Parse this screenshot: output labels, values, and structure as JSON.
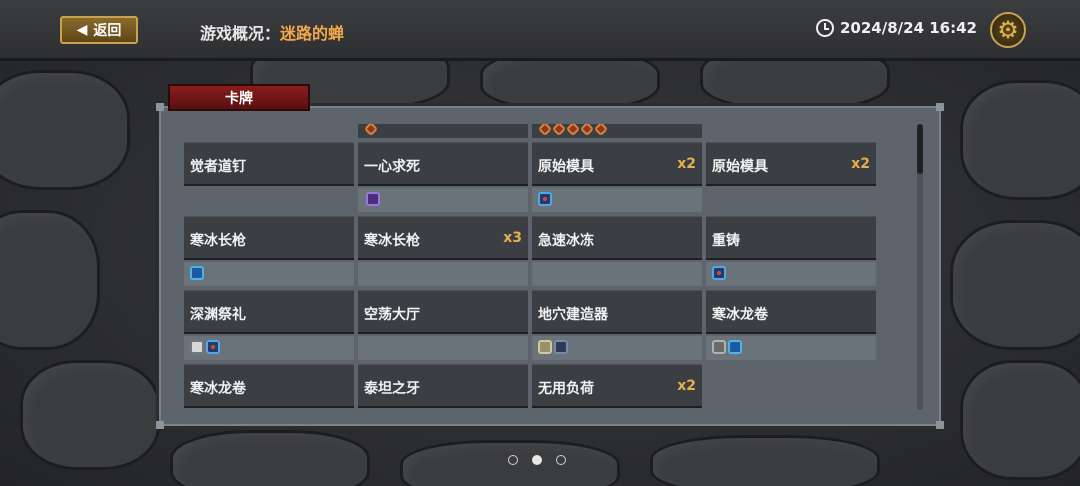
{
  "header": {
    "back_label": "返回",
    "title_prefix": "游戏概况：",
    "title_name": "迷路的蝉",
    "datetime": "2024/8/24 16:42"
  },
  "panel": {
    "tab_label": "卡牌"
  },
  "cards": [
    {
      "name": "觉者道钉",
      "count": ""
    },
    {
      "name": "一心求死",
      "count": ""
    },
    {
      "name": "原始模具",
      "count": "x2"
    },
    {
      "name": "原始模具",
      "count": "x2"
    },
    {
      "name": "寒冰长枪",
      "count": ""
    },
    {
      "name": "寒冰长枪",
      "count": "x3"
    },
    {
      "name": "急速冰冻",
      "count": ""
    },
    {
      "name": "重铸",
      "count": ""
    },
    {
      "name": "深渊祭礼",
      "count": ""
    },
    {
      "name": "空荡大厅",
      "count": ""
    },
    {
      "name": "地穴建造器",
      "count": ""
    },
    {
      "name": "寒冰龙卷",
      "count": ""
    },
    {
      "name": "寒冰龙卷",
      "count": ""
    },
    {
      "name": "泰坦之牙",
      "count": ""
    },
    {
      "name": "无用负荷",
      "count": "x2"
    }
  ],
  "pagination": {
    "pages": 3,
    "active": 2
  }
}
